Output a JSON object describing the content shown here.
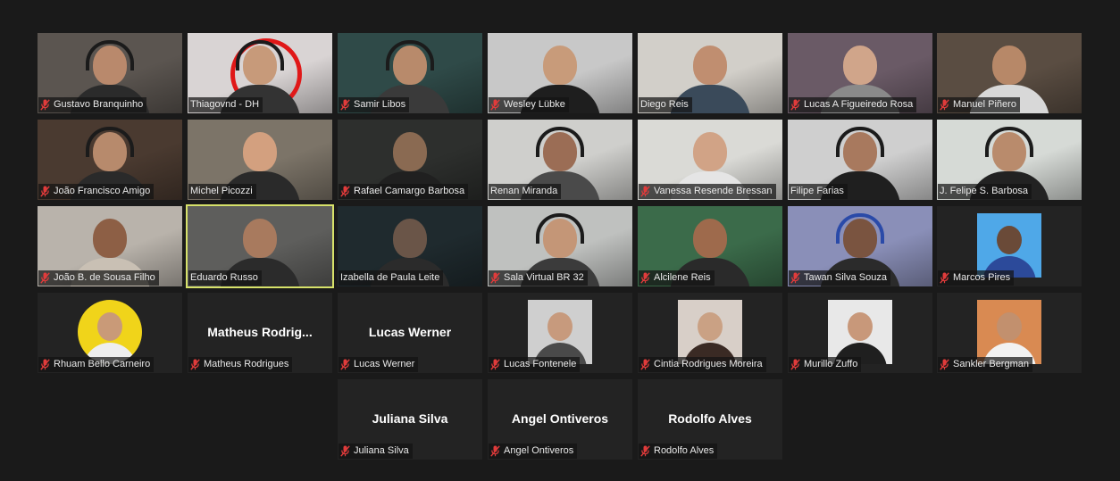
{
  "meeting": {
    "tiles": [
      {
        "name": "Gustavo Branquinho",
        "muted": true,
        "video": true,
        "bg": "#5b5550",
        "skin": "#b9896c",
        "shirt": "#2b2b2b",
        "headset": true
      },
      {
        "name": "Thiagovnd - DH",
        "muted": false,
        "video": true,
        "bg": "#d9d4d4",
        "skin": "#c79a7a",
        "shirt": "#333333",
        "headset": true,
        "ring": "#e01818"
      },
      {
        "name": "Samir Libos",
        "muted": true,
        "video": true,
        "bg": "#2f4a48",
        "skin": "#b88a6b",
        "shirt": "#3a3a3a",
        "headset": true
      },
      {
        "name": "Wesley Lübke",
        "muted": true,
        "video": true,
        "bg": "#c8c8c8",
        "skin": "#c89b7a",
        "shirt": "#1e1e1e",
        "headset": false
      },
      {
        "name": "Diego Reis",
        "muted": false,
        "video": true,
        "bg": "#d2cfc9",
        "skin": "#c08e70",
        "shirt": "#3a4a5a",
        "headset": false
      },
      {
        "name": "Lucas A Figueiredo Rosa",
        "muted": true,
        "video": true,
        "bg": "#6a5a66",
        "skin": "#d0a58a",
        "shirt": "#8a8a8a",
        "headset": false
      },
      {
        "name": "Manuel Piñero",
        "muted": true,
        "video": true,
        "bg": "#5a4d42",
        "skin": "#b78868",
        "shirt": "#d8d8d8",
        "headset": false
      },
      {
        "name": "João Francisco Amigo",
        "muted": true,
        "video": true,
        "bg": "#4a3a30",
        "skin": "#b78a6c",
        "shirt": "#2a2a2a",
        "headset": true
      },
      {
        "name": "Michel Picozzi",
        "muted": false,
        "video": true,
        "bg": "#7c7468",
        "skin": "#d3a07f",
        "shirt": "#2a2a2a",
        "headset": false
      },
      {
        "name": "Rafael Camargo Barbosa",
        "muted": true,
        "video": true,
        "bg": "#2d2f2d",
        "skin": "#8a6a52",
        "shirt": "#202020",
        "headset": false
      },
      {
        "name": "Renan Miranda",
        "muted": false,
        "video": true,
        "bg": "#cfcfcc",
        "skin": "#9b6d55",
        "shirt": "#4a4a4a",
        "headset": true
      },
      {
        "name": "Vanessa Resende Bressan",
        "muted": true,
        "video": true,
        "bg": "#dadad6",
        "skin": "#d1a386",
        "shirt": "#e5e5e5",
        "headset": false
      },
      {
        "name": "Filipe Farias",
        "muted": false,
        "video": true,
        "bg": "#cfcfcf",
        "skin": "#a8795e",
        "shirt": "#1f1f1f",
        "headset": true
      },
      {
        "name": "J. Felipe S. Barbosa",
        "muted": false,
        "video": true,
        "bg": "#d6dad6",
        "skin": "#b98b6c",
        "shirt": "#222222",
        "headset": true
      },
      {
        "name": "João B. de Sousa Filho",
        "muted": true,
        "video": true,
        "bg": "#b9b3ab",
        "skin": "#8d5f45",
        "shirt": "#c9c0b4",
        "headset": false
      },
      {
        "name": "Eduardo Russo",
        "muted": false,
        "video": true,
        "bg": "#5e5e5c",
        "skin": "#a87a5e",
        "shirt": "#2b2b2b",
        "headset": false,
        "active": true
      },
      {
        "name": "Izabella de Paula Leite",
        "muted": false,
        "video": true,
        "bg": "#1f2a2e",
        "skin": "#6a5548",
        "shirt": "#2b2b2b",
        "headset": false
      },
      {
        "name": "Sala Virtual BR 32",
        "muted": true,
        "video": true,
        "bg": "#bfc1bf",
        "skin": "#c49677",
        "shirt": "#3b3b3b",
        "headset": true
      },
      {
        "name": "Alcilene Reis",
        "muted": true,
        "video": true,
        "bg": "#3b6b4a",
        "skin": "#9e6a4c",
        "shirt": "#2a2a2a",
        "headset": false
      },
      {
        "name": "Tawan Silva Souza",
        "muted": true,
        "video": true,
        "bg": "#8a8fb8",
        "skin": "#7a5440",
        "shirt": "#2b2b2b",
        "headset": true,
        "headsetColor": "#2a4aa8"
      },
      {
        "name": "Marcos Pires",
        "muted": true,
        "video": false,
        "photo": true,
        "photoBg": "#4fa8e8",
        "photoSkin": "#6a4a38",
        "photoShirt": "#2c4a9a"
      },
      {
        "name": "Rhuam Bello Carneiro",
        "muted": true,
        "video": false,
        "photo": true,
        "round": true,
        "photoBg": "#f0d41a",
        "photoSkin": "#c99a78",
        "photoShirt": "#eeeeee"
      },
      {
        "name": "Matheus Rodrigues",
        "muted": true,
        "video": false,
        "center": "Matheus  Rodrig..."
      },
      {
        "name": "Lucas Werner",
        "muted": true,
        "video": false,
        "center": "Lucas Werner"
      },
      {
        "name": "Lucas Fontenele",
        "muted": true,
        "video": false,
        "photo": true,
        "photoBg": "#cfcfcf",
        "photoSkin": "#c79a7d",
        "photoShirt": "#4a4a4a"
      },
      {
        "name": "Cintia Rodrigues Moreira",
        "muted": true,
        "video": false,
        "photo": true,
        "photoBg": "#d8cfc8",
        "photoSkin": "#caa184",
        "photoShirt": "#3a2a24"
      },
      {
        "name": "Murillo Zuffo",
        "muted": true,
        "video": false,
        "photo": true,
        "photoBg": "#e8e8e8",
        "photoSkin": "#c8987a",
        "photoShirt": "#1f1f1f"
      },
      {
        "name": "Sankler Bergman",
        "muted": true,
        "video": false,
        "photo": true,
        "photoBg": "#d98a52",
        "photoSkin": "#c2906e",
        "photoShirt": "#f2f2f2"
      },
      {
        "name": "Juliana Silva",
        "muted": true,
        "video": false,
        "center": "Juliana Silva"
      },
      {
        "name": "Angel Ontiveros",
        "muted": true,
        "video": false,
        "center": "Angel Ontiveros"
      },
      {
        "name": "Rodolfo Alves",
        "muted": true,
        "video": false,
        "center": "Rodolfo Alves"
      }
    ]
  },
  "colors": {
    "background": "#1a1a1a",
    "emptyTile": "#232323",
    "activeSpeaker": "#d7e26a",
    "mutedMic": "#e03b3b"
  }
}
